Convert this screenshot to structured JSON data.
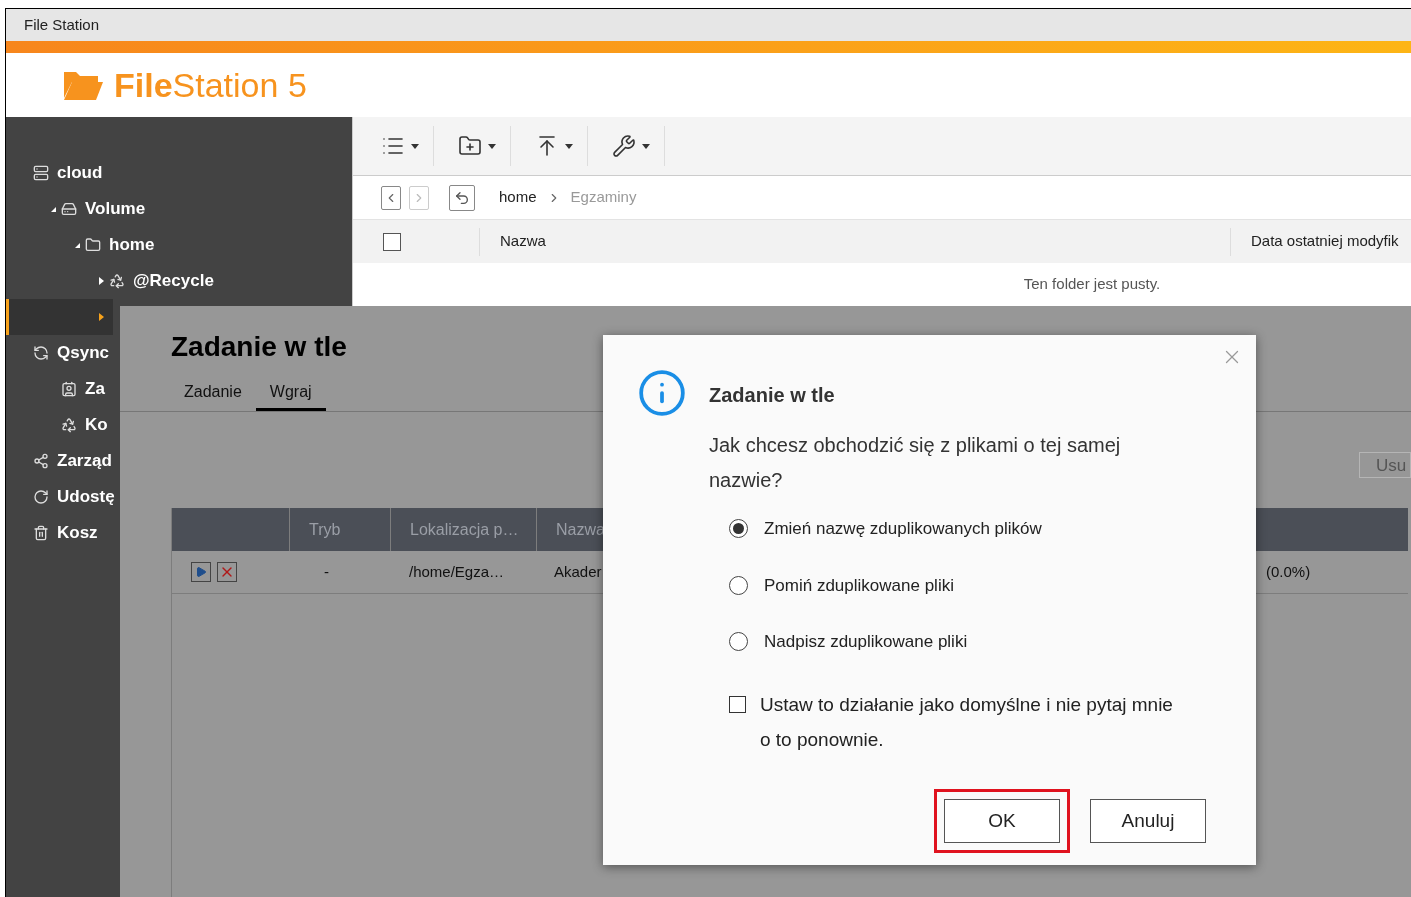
{
  "window": {
    "title": "File Station"
  },
  "app": {
    "name_bold": "File",
    "name_rest": "Station 5"
  },
  "sidebar": {
    "items": [
      {
        "label": "cloud",
        "kind": "server",
        "selected": false,
        "children": [
          {
            "label": "Volume",
            "kind": "drive",
            "expanded": true,
            "selected": false,
            "children": [
              {
                "label": "home",
                "kind": "folder",
                "expanded": true,
                "selected": false,
                "children": [
                  {
                    "label": "@Recycle",
                    "kind": "recycle",
                    "expanded": false,
                    "selected": false
                  },
                  {
                    "expanded": false,
                    "selected": true
                  }
                ]
              }
            ]
          }
        ]
      },
      {
        "label": "Qsync",
        "kind": "sync",
        "selected": false,
        "children": [
          {
            "label": "Za",
            "kind": "contact",
            "selected": false
          },
          {
            "label": "Ko",
            "kind": "recycle",
            "selected": false
          }
        ]
      },
      {
        "label": "Zarząd",
        "kind": "share",
        "selected": false
      },
      {
        "label": "Udostę",
        "kind": "rotate",
        "selected": false
      },
      {
        "label": "Kosz",
        "kind": "trash",
        "selected": false
      }
    ]
  },
  "toolbar": [
    {
      "kind": "list"
    },
    {
      "kind": "new-folder"
    },
    {
      "kind": "upload"
    },
    {
      "kind": "tools"
    }
  ],
  "breadcrumb": {
    "back_disabled": false,
    "forward_disabled": true,
    "path": [
      {
        "label": "home",
        "current": false
      },
      {
        "label": "Egzaminy",
        "current": true
      }
    ]
  },
  "file_table": {
    "select_all": false,
    "columns": [
      "Nazwa",
      "Data ostatniej modyfik"
    ],
    "empty_message": "Ten folder jest pusty."
  },
  "background_panel": {
    "title": "Zadanie w tle",
    "tabs": [
      {
        "label": "Zadanie",
        "selected": false
      },
      {
        "label": "Wgraj",
        "selected": true
      }
    ],
    "button": "Usu",
    "columns": [
      "",
      "Tryb",
      "Lokalizacja p…",
      "Nazwa"
    ],
    "rows": [
      {
        "mode": "-",
        "location": "/home/Egza…",
        "name": "Akader",
        "progress": "(0.0%)"
      }
    ]
  },
  "dialog": {
    "title": "Zadanie w tle",
    "message": "Jak chcesz obchodzić się z plikami o tej samej nazwie?",
    "options": [
      {
        "label": "Zmień nazwę zduplikowanych plików",
        "selected": true
      },
      {
        "label": "Pomiń zduplikowane pliki",
        "selected": false
      },
      {
        "label": "Nadpisz zduplikowane pliki",
        "selected": false
      }
    ],
    "default_checkbox": {
      "label": "Ustaw to działanie jako domyślne i nie pytaj mnie o to ponownie.",
      "checked": false
    },
    "buttons": [
      {
        "label": "OK",
        "highlighted": true
      },
      {
        "label": "Anuluj",
        "highlighted": false
      }
    ]
  }
}
